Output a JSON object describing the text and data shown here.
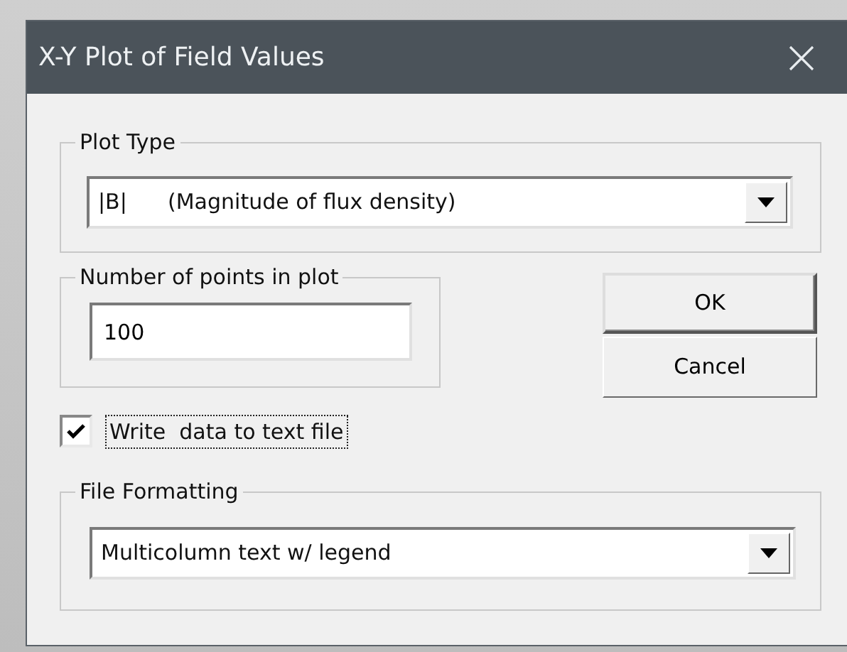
{
  "window": {
    "title": "X-Y Plot of Field Values"
  },
  "plot_type": {
    "label": "Plot Type",
    "value": "|B|      (Magnitude of flux density)"
  },
  "points": {
    "label": "Number of points in plot",
    "value": "100"
  },
  "write_to_file": {
    "label": "Write  data to text file",
    "checked": true,
    "focused": true
  },
  "file_formatting": {
    "label": "File Formatting",
    "value": "Multicolumn text w/ legend"
  },
  "buttons": [
    {
      "label": "OK",
      "default": true
    },
    {
      "label": "Cancel",
      "default": false
    }
  ]
}
